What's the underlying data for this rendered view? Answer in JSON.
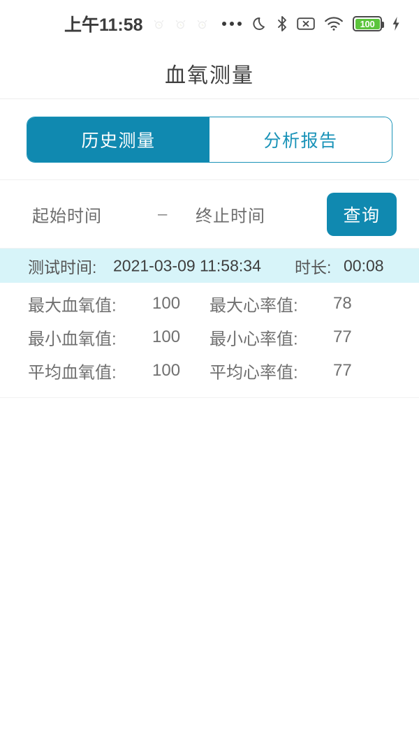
{
  "status_bar": {
    "time": "上午11:58",
    "left_icons": [
      "alarm-faint-icon",
      "alarm-faint-icon",
      "alarm-faint-icon"
    ],
    "overflow": "more-dots-icon",
    "right_icons": [
      "moon-dnd-icon",
      "bluetooth-icon",
      "no-sim-icon",
      "wifi-icon"
    ],
    "battery_level": "100",
    "battery_color": "#5bc43c",
    "charging": true
  },
  "header": {
    "title": "血氧测量"
  },
  "tabs": {
    "items": [
      {
        "label": "历史测量",
        "active": true
      },
      {
        "label": "分析报告",
        "active": false
      }
    ],
    "active_bg": "#1089b0",
    "border_color": "#1a93b8",
    "inactive_text": "#1a93b8"
  },
  "filter": {
    "start_placeholder": "起始时间",
    "separator": "–",
    "end_placeholder": "终止时间",
    "query_label": "查询",
    "query_bg": "#1089b0"
  },
  "record": {
    "highlight_bg": "#d7f4f9",
    "time_label": "测试时间:",
    "time_value": "2021-03-09 11:58:34",
    "duration_label": "时长:",
    "duration_value": "00:08",
    "rows": [
      {
        "label_a": "最大血氧值:",
        "value_a": "100",
        "label_b": "最大心率值:",
        "value_b": "78"
      },
      {
        "label_a": "最小血氧值:",
        "value_a": "100",
        "label_b": "最小心率值:",
        "value_b": "77"
      },
      {
        "label_a": "平均血氧值:",
        "value_a": "100",
        "label_b": "平均心率值:",
        "value_b": "77"
      }
    ]
  }
}
